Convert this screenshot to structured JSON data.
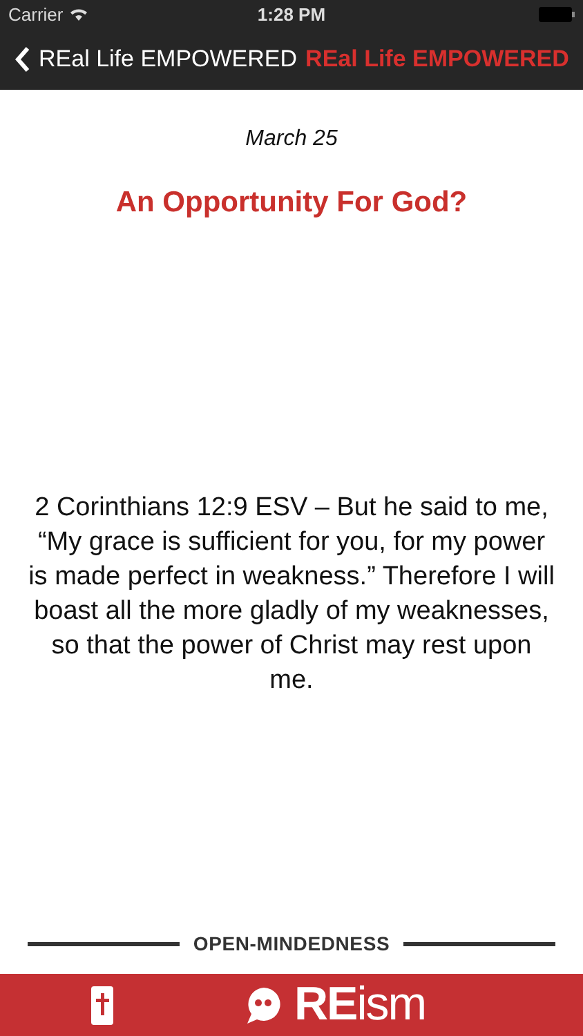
{
  "status_bar": {
    "carrier": "Carrier",
    "time": "1:28 PM"
  },
  "nav": {
    "back_label": "REal Life EMPOWERED",
    "title": "REal Life EMPOWERED"
  },
  "devotion": {
    "date": "March 25",
    "title": "An Opportunity For God?",
    "verse": "2 Corinthians 12:9 ESV – But he said to me, “My grace is sufficient for you, for my power is made perfect in weakness.” Therefore I will boast all the more gladly of my weaknesses, so that the power of Christ may rest upon me.",
    "theme": "OPEN-MINDEDNESS"
  },
  "tab_bar": {
    "logo": "**RE**ism"
  }
}
